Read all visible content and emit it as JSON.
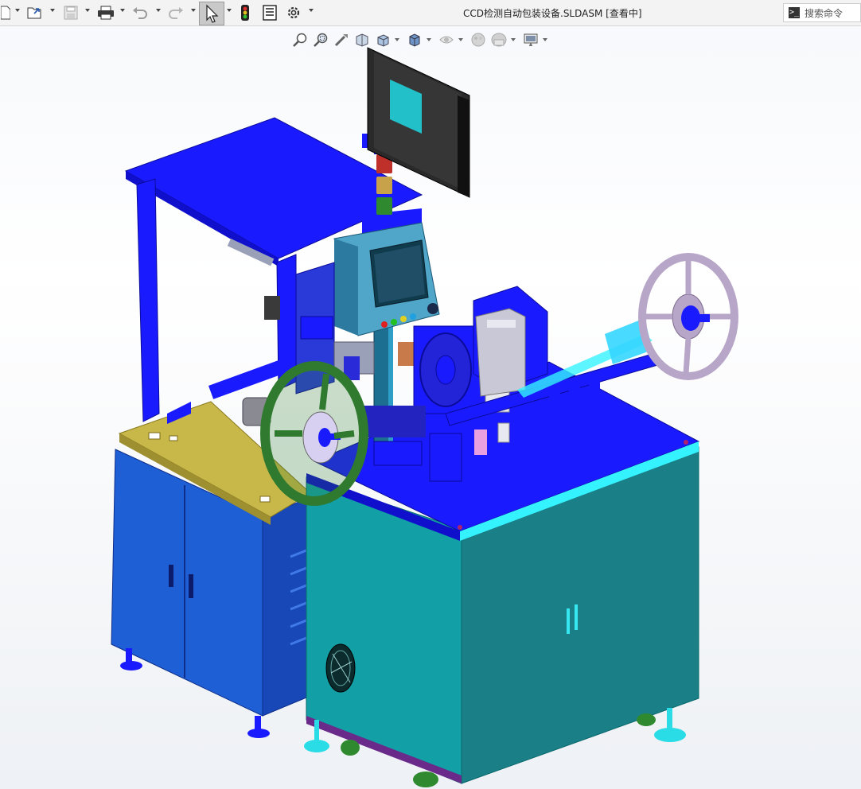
{
  "window": {
    "title": "CCD检测自动包装设备.SLDASM [查看中]"
  },
  "toolbar": {
    "buttons": [
      {
        "name": "new-document-icon"
      },
      {
        "name": "open-icon"
      },
      {
        "name": "save-icon"
      },
      {
        "name": "print-icon"
      },
      {
        "name": "undo-icon"
      },
      {
        "name": "redo-icon"
      },
      {
        "name": "select-pointer-icon"
      },
      {
        "name": "rebuild-traffic-light-icon"
      },
      {
        "name": "file-properties-icon"
      },
      {
        "name": "options-gear-icon"
      }
    ]
  },
  "search": {
    "placeholder": "搜索命令",
    "prompt_glyph": ">_"
  },
  "heads_up_toolbar": {
    "buttons": [
      {
        "name": "zoom-to-fit-icon"
      },
      {
        "name": "zoom-to-area-icon"
      },
      {
        "name": "previous-view-icon"
      },
      {
        "name": "section-view-icon"
      },
      {
        "name": "view-orientation-icon"
      },
      {
        "name": "display-style-icon"
      },
      {
        "name": "hide-show-items-icon"
      },
      {
        "name": "edit-appearance-icon"
      },
      {
        "name": "apply-scene-icon"
      },
      {
        "name": "view-settings-icon"
      }
    ]
  },
  "colors": {
    "machine_blue": "#1a1aff",
    "cabinet_blue": "#1f5fd6",
    "cabinet_teal": "#12a0a6",
    "table_yellow": "#c8b84a",
    "reel_green": "#2f7a2f",
    "reel_lavender": "#b8a6c8",
    "cyan_glow": "#35f2ff"
  }
}
